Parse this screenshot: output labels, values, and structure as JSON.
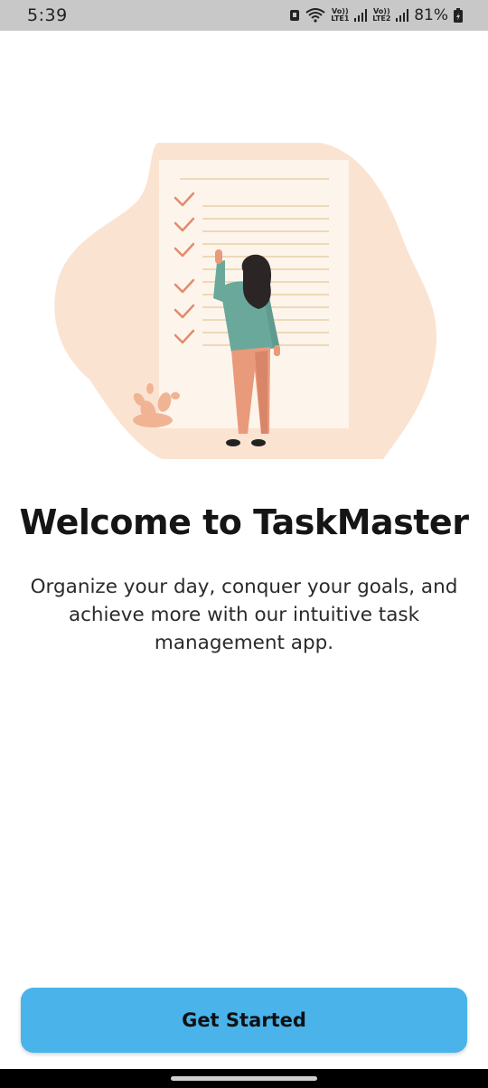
{
  "status_bar": {
    "time": "5:39",
    "battery_percent": "81%",
    "sim1_label": "Vo)) LTE1",
    "sim2_label": "Vo)) LTE2",
    "icons": [
      "notification-icon",
      "wifi-icon",
      "signal-icon",
      "battery-icon"
    ]
  },
  "illustration": {
    "icon": "todo-checklist-illustration",
    "colors": {
      "blob": "#fbe3d2",
      "paper": "#fdf5ec",
      "check": "#e38b6d",
      "shirt": "#6aa89b",
      "pants": "#e99a7b",
      "hair": "#2b2525"
    }
  },
  "welcome": {
    "title": "Welcome to TaskMaster",
    "subtitle": "Organize your day, conquer your goals, and achieve more with our intuitive task management app."
  },
  "cta": {
    "label": "Get Started",
    "color": "#4ab3ea"
  }
}
